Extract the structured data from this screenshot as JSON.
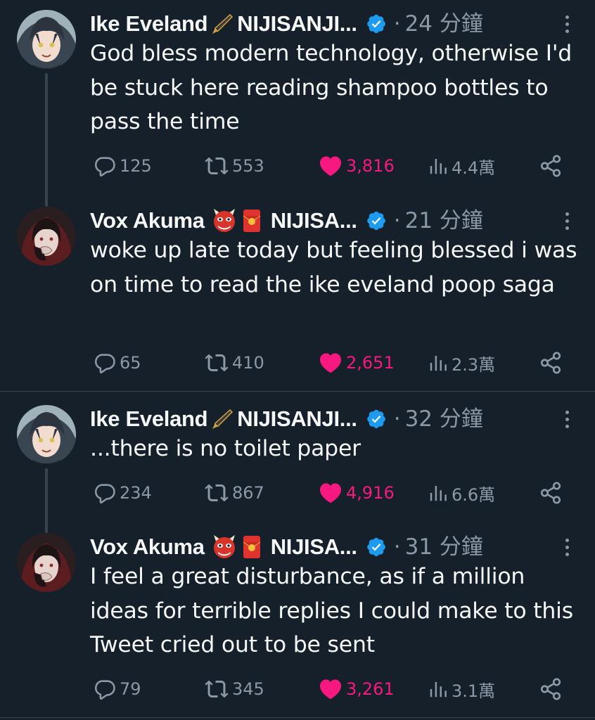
{
  "colors": {
    "background": "#15202b",
    "text": "#f7f9f9",
    "muted": "#8b98a5",
    "like": "#f91880",
    "verified": "#1d9bf0",
    "divider": "#38444d"
  },
  "tweets": [
    {
      "author": "Ike Eveland",
      "author_suffix": "NIJISANJI...",
      "name_emojis": [
        "fountain-pen-emoji"
      ],
      "separator": "·",
      "time": "24 分鐘",
      "text": "God bless modern technology, otherwise I'd be stuck here reading shampoo bottles to pass the time",
      "stats": {
        "replies": "125",
        "retweets": "553",
        "likes": "3,816",
        "views": "4.4萬"
      },
      "liked": true
    },
    {
      "author": "Vox Akuma",
      "author_suffix": "NIJISA...",
      "name_emojis": [
        "ogre-emoji",
        "red-envelope-emoji"
      ],
      "separator": "·",
      "time": "21 分鐘",
      "text": "woke up late today but feeling blessed i was on time to read the ike eveland poop saga",
      "stats": {
        "replies": "65",
        "retweets": "410",
        "likes": "2,651",
        "views": "2.3萬"
      },
      "liked": true
    },
    {
      "author": "Ike Eveland",
      "author_suffix": "NIJISANJI...",
      "name_emojis": [
        "fountain-pen-emoji"
      ],
      "separator": "·",
      "time": "32 分鐘",
      "text": "...there is no toilet paper",
      "stats": {
        "replies": "234",
        "retweets": "867",
        "likes": "4,916",
        "views": "6.6萬"
      },
      "liked": true
    },
    {
      "author": "Vox Akuma",
      "author_suffix": "NIJISA...",
      "name_emojis": [
        "ogre-emoji",
        "red-envelope-emoji"
      ],
      "separator": "·",
      "time": "31 分鐘",
      "text": "I feel a great disturbance, as if a million ideas for terrible replies I could make to this Tweet cried out to be sent",
      "stats": {
        "replies": "79",
        "retweets": "345",
        "likes": "3,261",
        "views": "3.1萬"
      },
      "liked": true
    }
  ]
}
